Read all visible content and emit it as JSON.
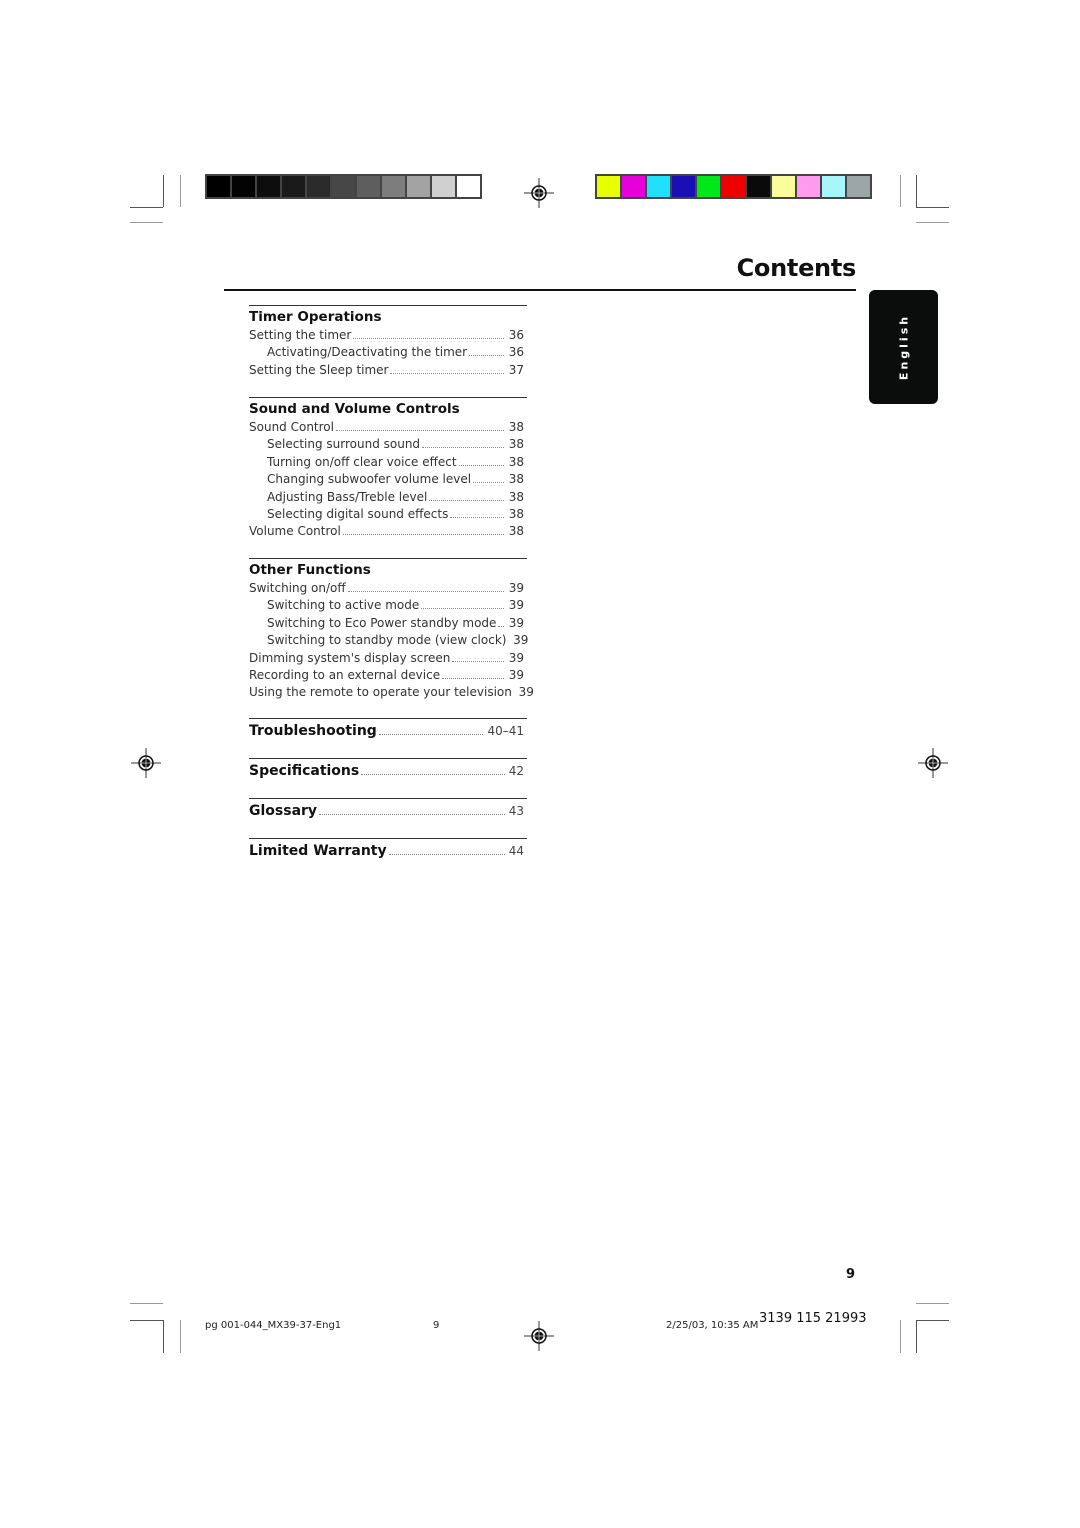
{
  "print_marks": {
    "grayscale_bar": [
      "#000000",
      "#030303",
      "#0d0d0d",
      "#1a1a1a",
      "#2a2a2a",
      "#474747",
      "#5e5e5e",
      "#7d7d7d",
      "#a3a3a3",
      "#d0d0d0",
      "#ffffff"
    ],
    "color_bar": [
      "#e8ff00",
      "#e600d9",
      "#1fe0ff",
      "#1a0fb5",
      "#00e81a",
      "#ee0000",
      "#0a0a0a",
      "#fbfd9a",
      "#ff9cf0",
      "#a8f6fd",
      "#9da6a6"
    ],
    "icons": [
      "crop-mark-icon",
      "registration-target-icon"
    ]
  },
  "header": {
    "title": "Contents",
    "language_tab": "English"
  },
  "toc": {
    "sections": [
      {
        "title": "Timer Operations",
        "entries": [
          {
            "label": "Setting the timer",
            "page": "36",
            "level": 1
          },
          {
            "label": "Activating/Deactivating the timer",
            "page": "36",
            "level": 2
          },
          {
            "label": "Setting the Sleep timer",
            "page": "37",
            "level": 1
          }
        ]
      },
      {
        "title": "Sound and Volume Controls",
        "entries": [
          {
            "label": "Sound Control",
            "page": "38",
            "level": 1
          },
          {
            "label": "Selecting surround sound",
            "page": "38",
            "level": 2
          },
          {
            "label": "Turning on/off clear voice effect",
            "page": "38",
            "level": 2
          },
          {
            "label": "Changing subwoofer volume level",
            "page": "38",
            "level": 2
          },
          {
            "label": "Adjusting Bass/Treble level",
            "page": "38",
            "level": 2
          },
          {
            "label": "Selecting digital sound effects",
            "page": "38",
            "level": 2
          },
          {
            "label": "Volume Control",
            "page": "38",
            "level": 1
          }
        ]
      },
      {
        "title": "Other Functions",
        "entries": [
          {
            "label": "Switching on/off",
            "page": "39",
            "level": 1
          },
          {
            "label": "Switching to active mode",
            "page": "39",
            "level": 2
          },
          {
            "label": "Switching to Eco Power standby mode",
            "page": "39",
            "level": 2
          },
          {
            "label": "Switching to standby mode (view clock)",
            "page": "39",
            "level": 2
          },
          {
            "label": "Dimming system's display screen",
            "page": "39",
            "level": 1
          },
          {
            "label": "Recording to an external device",
            "page": "39",
            "level": 1
          },
          {
            "label": "Using the remote to operate your television",
            "page": "39",
            "level": 1
          }
        ]
      }
    ],
    "chapters": [
      {
        "label": "Troubleshooting",
        "page": "40–41"
      },
      {
        "label": "Specifications",
        "page": "42"
      },
      {
        "label": "Glossary",
        "page": "43"
      },
      {
        "label": "Limited Warranty",
        "page": "44"
      }
    ]
  },
  "footer": {
    "page_number": "9",
    "file_name": "pg 001-044_MX39-37-Eng1",
    "sheet_number": "9",
    "timestamp": "2/25/03, 10:35 AM",
    "product_code": "3139 115 21993"
  }
}
